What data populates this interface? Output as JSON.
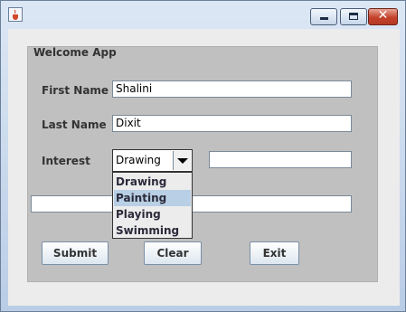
{
  "window": {
    "title": ""
  },
  "panel": {
    "title": "Welcome App"
  },
  "form": {
    "first_name_label": "First Name",
    "first_name_value": "Shalini",
    "last_name_label": "Last Name",
    "last_name_value": "Dixit",
    "interest_label": "Interest",
    "interest_selected": "Drawing",
    "interest_options": [
      "Drawing",
      "Painting",
      "Playing",
      "Swimming"
    ],
    "highlighted_option": "Painting",
    "interest_text_value": "",
    "output_text_value": ""
  },
  "buttons": {
    "submit": "Submit",
    "clear": "Clear",
    "exit": "Exit"
  },
  "icons": {
    "app": "java-cup-icon",
    "minimize": "minimize-icon",
    "maximize": "maximize-icon",
    "close": "close-icon",
    "dropdown": "chevron-down-icon"
  },
  "colors": {
    "panel_background": "#c0c0c0",
    "selected_option": "#b8cfe5",
    "close_button": "#c4412b"
  }
}
